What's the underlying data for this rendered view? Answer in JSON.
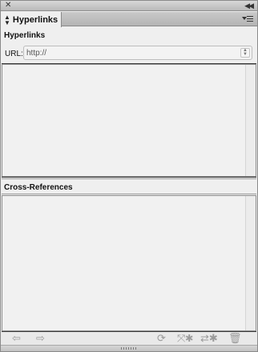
{
  "window": {
    "close_icon": "close-icon",
    "collapse_icon": "double-chevron-icon"
  },
  "tab": {
    "label": "Hyperlinks",
    "arrows_icon": "up-down-arrows-icon",
    "menu_icon": "panel-menu-icon"
  },
  "hyperlinks": {
    "heading": "Hyperlinks",
    "url_label": "URL:",
    "url_value": "http://"
  },
  "cross_references": {
    "heading": "Cross-References"
  },
  "toolbar": {
    "buttons": [
      {
        "name": "go-to-source-icon"
      },
      {
        "name": "go-to-destination-icon"
      },
      {
        "name": "update-icon"
      },
      {
        "name": "create-hyperlink-icon"
      },
      {
        "name": "create-cross-reference-icon"
      },
      {
        "name": "delete-icon"
      }
    ]
  }
}
